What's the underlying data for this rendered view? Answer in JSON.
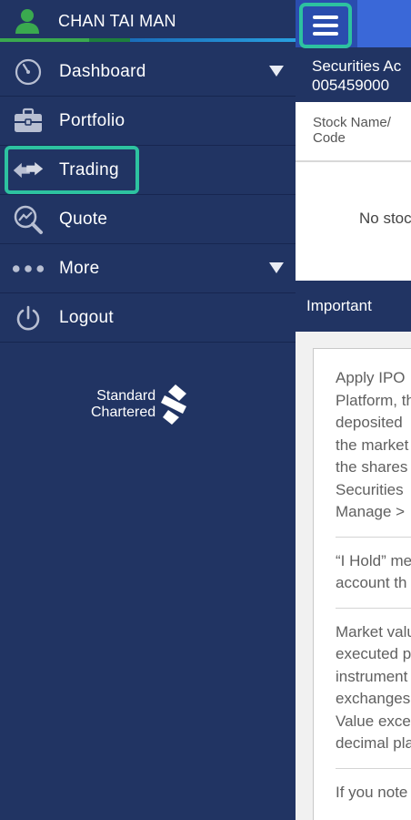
{
  "user": {
    "name": "CHAN TAI MAN"
  },
  "menu": {
    "items": [
      {
        "label": "Dashboard",
        "icon": "compass-icon"
      },
      {
        "label": "Portfolio",
        "icon": "briefcase-icon"
      },
      {
        "label": "Trading",
        "icon": "swap-arrows-icon"
      },
      {
        "label": "Quote",
        "icon": "chart-search-icon"
      },
      {
        "label": "More",
        "icon": "more-dots-icon"
      },
      {
        "label": "Logout",
        "icon": "power-icon"
      }
    ]
  },
  "brand": {
    "line1": "Standard",
    "line2": "Chartered"
  },
  "main": {
    "account_title": "Securities Ac",
    "account_number": "005459000",
    "column_header_line1": "Stock Name/",
    "column_header_line2": "Code",
    "empty_message": "No stoc",
    "important_label": "Important",
    "notes": [
      [
        "Apply IPO",
        "Platform, th",
        "deposited",
        "the market",
        "the shares",
        "Securities",
        "Manage >"
      ],
      [
        "“I Hold” me",
        "account th"
      ],
      [
        "Market valu",
        "executed p",
        "instrument",
        "exchanges",
        "Value exce",
        "decimal pla"
      ],
      [
        "If you note"
      ]
    ]
  },
  "colors": {
    "sidebar_bg": "#213463",
    "highlight": "#2dc2a0",
    "topbar": "#2a4dae",
    "avatar_green": "#3aa94f"
  }
}
